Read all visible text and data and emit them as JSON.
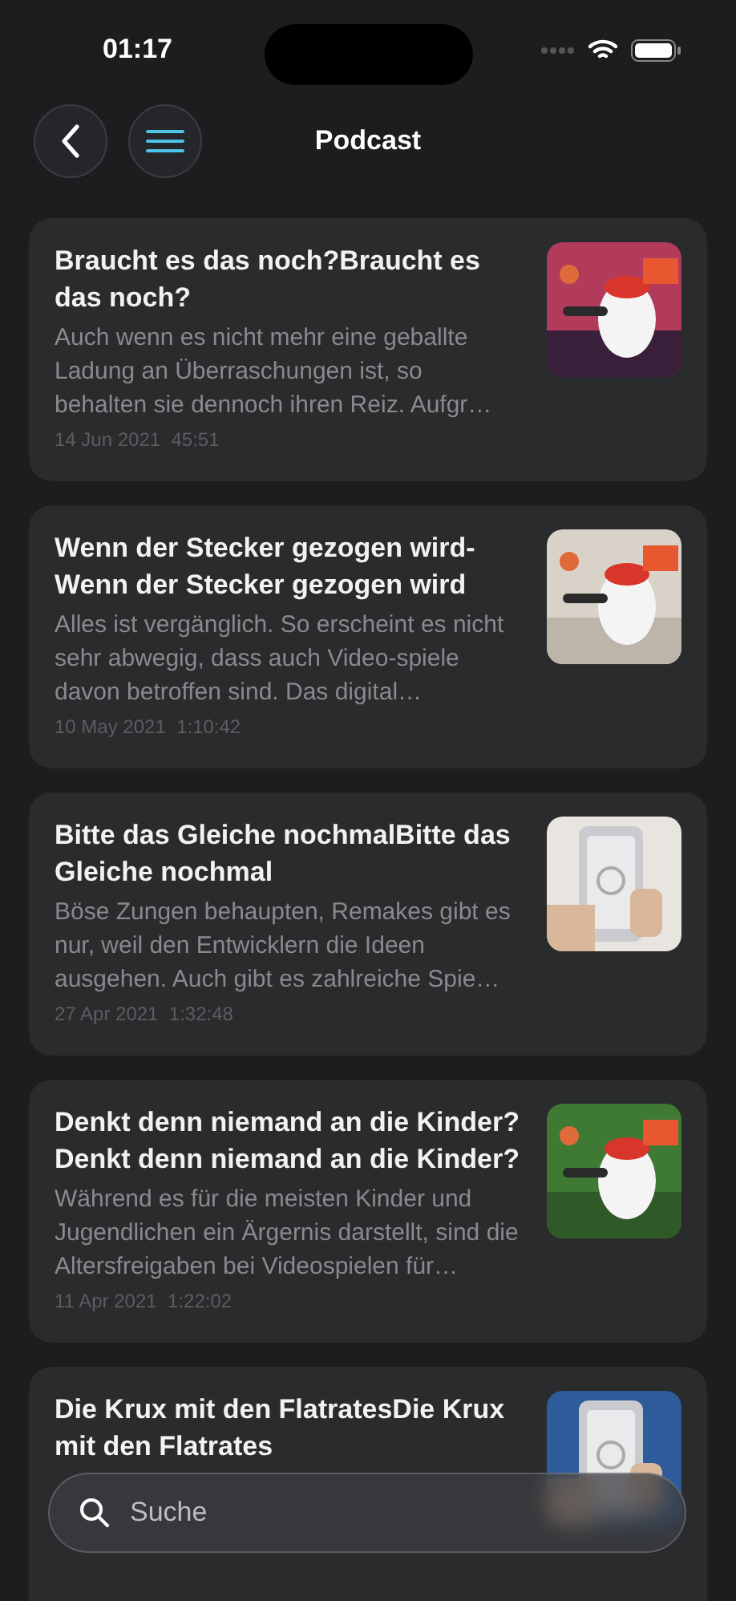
{
  "status_bar": {
    "time": "01:17"
  },
  "header": {
    "title": "Podcast"
  },
  "episodes": [
    {
      "title": "Braucht es das noch?Braucht es das noch?",
      "description": "Auch wenn es nicht mehr eine geballte Ladung an Überraschungen ist, so behalten sie dennoch ihren Reiz. Aufgr…",
      "date": "14 Jun 2021",
      "duration": "45:51"
    },
    {
      "title": "Wenn der Stecker gezogen wird-Wenn der Stecker gezogen wird",
      "description": "Alles ist vergänglich. So erscheint es nicht sehr abwegig, dass auch Video-spiele davon betroffen sind. Das digital…",
      "date": "10 May 2021",
      "duration": "1:10:42"
    },
    {
      "title": "Bitte das Gleiche nochmalBitte das Gleiche nochmal",
      "description": "Böse Zungen behaupten, Remakes gibt es nur, weil den Entwicklern die Ideen ausgehen. Auch gibt es zahlreiche Spie…",
      "date": "27 Apr 2021",
      "duration": "1:32:48"
    },
    {
      "title": "Denkt denn niemand an die Kinder? Denkt denn niemand an die Kinder?",
      "description": "Während es für die meisten Kinder und Jugendlichen ein Ärgernis darstellt, sind die Altersfreigaben bei Videospielen für…",
      "date": "11 Apr 2021",
      "duration": "1:22:02"
    },
    {
      "title": "Die Krux mit den FlatratesDie Krux mit den Flatrates"
    }
  ],
  "search": {
    "placeholder": "Suche"
  }
}
